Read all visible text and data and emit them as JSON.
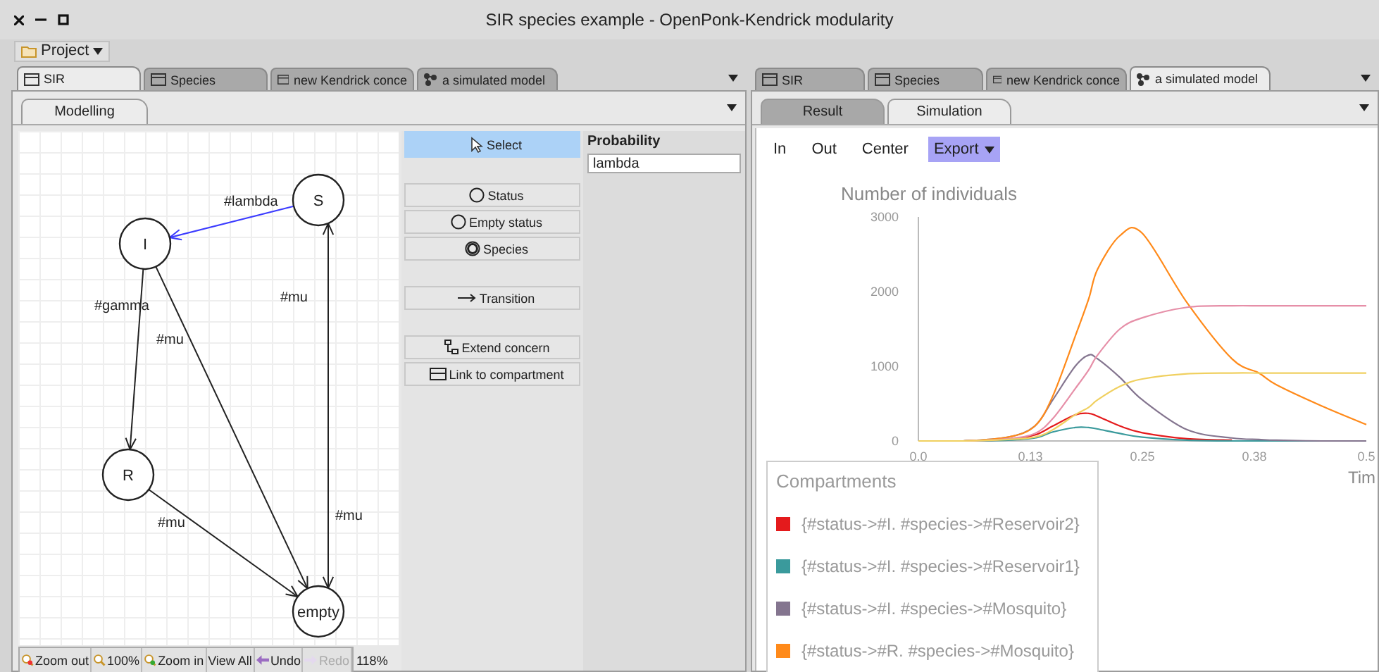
{
  "window": {
    "title": "SIR species example - OpenPonk-Kendrick modularity"
  },
  "menu": {
    "label": "Project"
  },
  "left_pane": {
    "tabs": [
      {
        "label": "SIR",
        "kind": "editor",
        "selected": true
      },
      {
        "label": "Species",
        "kind": "editor",
        "selected": false
      },
      {
        "label": "new Kendrick conce",
        "kind": "editor",
        "selected": false
      },
      {
        "label": "a simulated model",
        "kind": "simulation",
        "selected": false
      }
    ],
    "subtabs": [
      {
        "label": "Modelling",
        "selected": true
      }
    ],
    "diagram": {
      "nodes": [
        {
          "label": "S"
        },
        {
          "label": "I"
        },
        {
          "label": "R"
        },
        {
          "label": "empty"
        }
      ],
      "edges": [
        {
          "label": "#lambda",
          "selected": true
        },
        {
          "label": "#gamma",
          "selected": false
        },
        {
          "label": "#mu",
          "selected": false
        },
        {
          "label": "#mu",
          "selected": false
        },
        {
          "label": "#mu",
          "selected": false
        },
        {
          "label": "#mu",
          "selected": false
        }
      ]
    },
    "palette": {
      "groups": [
        {
          "items": [
            {
              "label": "Select",
              "kind": "pointer",
              "selected": true
            }
          ]
        },
        {
          "items": [
            {
              "label": "Status",
              "kind": "status",
              "selected": false
            },
            {
              "label": "Empty status",
              "kind": "empty",
              "selected": false
            },
            {
              "label": "Species",
              "kind": "species",
              "selected": false
            }
          ]
        },
        {
          "items": [
            {
              "label": "Transition",
              "kind": "transition",
              "selected": false
            }
          ]
        },
        {
          "items": [
            {
              "label": "Extend concern",
              "kind": "concern",
              "selected": false
            },
            {
              "label": "Link to compartment",
              "kind": "compartment",
              "selected": false
            }
          ]
        }
      ]
    },
    "properties": {
      "label": "Probability",
      "value": "lambda"
    },
    "zoom_toolbar": {
      "buttons": [
        {
          "label": "Zoom out",
          "kind": "zoomout",
          "disabled": false
        },
        {
          "label": "100%",
          "kind": "zoomreset",
          "disabled": false
        },
        {
          "label": "Zoom in",
          "kind": "zoomin",
          "disabled": false
        },
        {
          "label": "View All",
          "kind": "text",
          "disabled": false
        },
        {
          "label": "Undo",
          "kind": "undo",
          "disabled": false
        },
        {
          "label": "Redo",
          "kind": "redo",
          "disabled": true
        }
      ],
      "zoom": "118%"
    }
  },
  "right_pane": {
    "tabs": [
      {
        "label": "SIR",
        "kind": "editor",
        "selected": false
      },
      {
        "label": "Species",
        "kind": "editor",
        "selected": false
      },
      {
        "label": "new Kendrick conce",
        "kind": "editor",
        "selected": false
      },
      {
        "label": "a simulated model",
        "kind": "simulation",
        "selected": true
      }
    ],
    "subtabs": [
      {
        "label": "Result",
        "selected": false
      },
      {
        "label": "Simulation",
        "selected": true
      }
    ],
    "toolbar": [
      {
        "label": "In",
        "kind": "button"
      },
      {
        "label": "Out",
        "kind": "button"
      },
      {
        "label": "Center",
        "kind": "button"
      },
      {
        "label": "Export",
        "kind": "dropdown"
      }
    ],
    "legend_title": "Compartments",
    "chart_data": {
      "type": "line",
      "title": "Number of individuals",
      "xlabel": "Tim",
      "x": [
        0,
        0.05,
        0.1,
        0.13,
        0.15,
        0.175,
        0.19,
        0.2,
        0.225,
        0.25,
        0.3,
        0.35,
        0.38,
        0.4,
        0.45,
        0.5
      ],
      "xlim": [
        0,
        0.5
      ],
      "ylim": [
        0,
        3000
      ],
      "xticks": [
        {
          "value": 0,
          "label": "0.0"
        },
        {
          "value": 0.125,
          "label": "0.13"
        },
        0.25,
        {
          "value": 0.375,
          "label": "0.38"
        },
        0.5
      ],
      "yticks": [
        0,
        1000,
        2000,
        3000
      ],
      "series": [
        {
          "name": "{#status->#I. #species->#Reservoir2}",
          "color": "#e41a1c",
          "values": [
            0,
            0,
            20,
            80,
            200,
            350,
            370,
            330,
            200,
            110,
            30,
            10,
            null,
            null,
            null,
            null
          ]
        },
        {
          "name": "{#status->#I. #species->#Reservoir1}",
          "color": "#3a9a9c",
          "values": [
            0,
            0,
            10,
            40,
            120,
            180,
            180,
            160,
            100,
            50,
            10,
            0,
            0,
            0,
            0,
            0
          ]
        },
        {
          "name": "{#status->#I. #species->#Mosquito}",
          "color": "#84758f",
          "values": [
            0,
            0,
            50,
            200,
            550,
            1000,
            1150,
            1100,
            850,
            550,
            150,
            40,
            20,
            10,
            0,
            0
          ]
        },
        {
          "name": "{#status->#R. #species->#Mosquito}",
          "color": "#ff8a1a",
          "values": [
            0,
            0,
            50,
            200,
            600,
            1400,
            1900,
            2300,
            2750,
            2780,
            1850,
            1100,
            910,
            750,
            470,
            220
          ]
        },
        {
          "color": "#e68fa8",
          "values": [
            0,
            0,
            30,
            100,
            300,
            700,
            950,
            1150,
            1500,
            1650,
            1790,
            1810,
            1810,
            1810,
            1810,
            1810
          ]
        },
        {
          "color": "#f0d060",
          "values": [
            0,
            0,
            20,
            50,
            150,
            350,
            450,
            550,
            730,
            830,
            900,
            910,
            910,
            910,
            910,
            910
          ]
        }
      ]
    }
  }
}
